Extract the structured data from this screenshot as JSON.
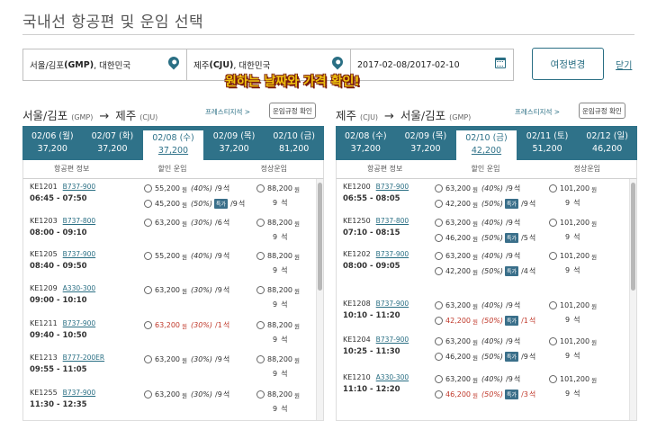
{
  "title": "국내선 항공편 및 운임 선택",
  "search": {
    "from": {
      "city": "서울/김포",
      "code": "(GMP)",
      "country": ", 대한민국"
    },
    "to": {
      "city": "제주",
      "code": "(CJU)",
      "country": ", 대한민국"
    },
    "dates": "2017-02-08/2017-02-10"
  },
  "buttons": {
    "change": "여정변경",
    "close": "닫기"
  },
  "annotation": "원하는 날짜와 가격 확인!",
  "common": {
    "won": "원",
    "seat": "석",
    "special": "특가"
  },
  "outbound": {
    "from": "서울/김포",
    "from_code": "(GMP)",
    "arrow": "→",
    "to": "제주",
    "to_code": "(CJU)",
    "prestige": "프레스티지석 >",
    "fare_rules": "운임규정 확인",
    "col_flight": "항공편 정보",
    "col_disc": "할인 운임",
    "col_reg": "정상운임",
    "tabs": [
      {
        "date": "02/06 (월)",
        "price": "37,200"
      },
      {
        "date": "02/07 (화)",
        "price": "37,200"
      },
      {
        "date": "02/08 (수)",
        "price": "37,200"
      },
      {
        "date": "02/09 (목)",
        "price": "37,200"
      },
      {
        "date": "02/10 (금)",
        "price": "81,200"
      }
    ],
    "selected_tab": 2,
    "flights": [
      {
        "no": "KE1201",
        "ac": "B737-900",
        "time": "06:45 - 07:50",
        "fares": [
          {
            "price": "55,200",
            "pct": "(40%)",
            "seats": "/9",
            "special": false,
            "red": false
          },
          {
            "price": "45,200",
            "pct": "(50%)",
            "seats": "/9",
            "special": true,
            "red": false
          }
        ],
        "reg_price": "88,200",
        "reg_seats": "9"
      },
      {
        "no": "KE1203",
        "ac": "B737-800",
        "time": "08:00 - 09:10",
        "fares": [
          {
            "price": "63,200",
            "pct": "(30%)",
            "seats": "/6",
            "special": false,
            "red": false
          }
        ],
        "reg_price": "88,200",
        "reg_seats": "9"
      },
      {
        "no": "KE1205",
        "ac": "B737-900",
        "time": "08:40 - 09:50",
        "fares": [
          {
            "price": "55,200",
            "pct": "(40%)",
            "seats": "/9",
            "special": false,
            "red": false
          }
        ],
        "reg_price": "88,200",
        "reg_seats": "9"
      },
      {
        "no": "KE1209",
        "ac": "A330-300",
        "time": "09:00 - 10:10",
        "fares": [
          {
            "price": "63,200",
            "pct": "(30%)",
            "seats": "/9",
            "special": false,
            "red": false
          }
        ],
        "reg_price": "88,200",
        "reg_seats": "9"
      },
      {
        "no": "KE1211",
        "ac": "B737-900",
        "time": "09:40 - 10:50",
        "fares": [
          {
            "price": "63,200",
            "pct": "(30%)",
            "seats": "/1",
            "special": false,
            "red": true
          }
        ],
        "reg_price": "88,200",
        "reg_seats": "9"
      },
      {
        "no": "KE1213",
        "ac": "B777-200ER",
        "time": "09:55 - 11:05",
        "fares": [
          {
            "price": "63,200",
            "pct": "(30%)",
            "seats": "/9",
            "special": false,
            "red": false
          }
        ],
        "reg_price": "88,200",
        "reg_seats": "9"
      },
      {
        "no": "KE1255",
        "ac": "B737-900",
        "time": "11:30 - 12:35",
        "fares": [
          {
            "price": "63,200",
            "pct": "(30%)",
            "seats": "/9",
            "special": false,
            "red": false
          }
        ],
        "reg_price": "88,200",
        "reg_seats": "9"
      }
    ]
  },
  "inbound": {
    "from": "제주",
    "from_code": "(CJU)",
    "arrow": "→",
    "to": "서울/김포",
    "to_code": "(GMP)",
    "prestige": "프레스티지석 >",
    "fare_rules": "운임규정 확인",
    "col_flight": "항공편 정보",
    "col_disc": "할인 운임",
    "col_reg": "정상운임",
    "tabs": [
      {
        "date": "02/08 (수)",
        "price": "37,200"
      },
      {
        "date": "02/09 (목)",
        "price": "37,200"
      },
      {
        "date": "02/10 (금)",
        "price": "42,200"
      },
      {
        "date": "02/11 (토)",
        "price": "51,200"
      },
      {
        "date": "02/12 (일)",
        "price": "46,200"
      }
    ],
    "selected_tab": 2,
    "flights": [
      {
        "no": "KE1200",
        "ac": "B737-900",
        "time": "06:55 - 08:05",
        "fares": [
          {
            "price": "63,200",
            "pct": "(40%)",
            "seats": "/9",
            "special": false,
            "red": false
          },
          {
            "price": "42,200",
            "pct": "(50%)",
            "seats": "/9",
            "special": true,
            "red": false
          }
        ],
        "reg_price": "101,200",
        "reg_seats": "9"
      },
      {
        "no": "KE1250",
        "ac": "B737-800",
        "time": "07:10 - 08:15",
        "fares": [
          {
            "price": "63,200",
            "pct": "(40%)",
            "seats": "/9",
            "special": false,
            "red": false
          },
          {
            "price": "46,200",
            "pct": "(50%)",
            "seats": "/5",
            "special": true,
            "red": false
          }
        ],
        "reg_price": "101,200",
        "reg_seats": "9"
      },
      {
        "no": "KE1202",
        "ac": "B737-900",
        "time": "08:00 - 09:05",
        "fares": [
          {
            "price": "63,200",
            "pct": "(40%)",
            "seats": "/9",
            "special": false,
            "red": false
          },
          {
            "price": "42,200",
            "pct": "(50%)",
            "seats": "/4",
            "special": true,
            "red": false
          }
        ],
        "reg_price": "101,200",
        "reg_seats": "9"
      },
      {
        "no": "KE1208",
        "ac": "B737-900",
        "time": "10:10 - 11:20",
        "fares": [
          {
            "price": "63,200",
            "pct": "(40%)",
            "seats": "/9",
            "special": false,
            "red": false
          },
          {
            "price": "42,200",
            "pct": "(50%)",
            "seats": "/1",
            "special": true,
            "red": true
          }
        ],
        "reg_price": "101,200",
        "reg_seats": "9"
      },
      {
        "no": "KE1204",
        "ac": "B737-900",
        "time": "10:25 - 11:30",
        "fares": [
          {
            "price": "63,200",
            "pct": "(40%)",
            "seats": "/9",
            "special": false,
            "red": false
          },
          {
            "price": "46,200",
            "pct": "(50%)",
            "seats": "/9",
            "special": true,
            "red": false
          }
        ],
        "reg_price": "101,200",
        "reg_seats": "9"
      },
      {
        "no": "KE1210",
        "ac": "A330-300",
        "time": "11:10 - 12:20",
        "fares": [
          {
            "price": "63,200",
            "pct": "(40%)",
            "seats": "/9",
            "special": false,
            "red": false
          },
          {
            "price": "46,200",
            "pct": "(50%)",
            "seats": "/3",
            "special": true,
            "red": true
          }
        ],
        "reg_price": "101,200",
        "reg_seats": "9"
      }
    ]
  }
}
